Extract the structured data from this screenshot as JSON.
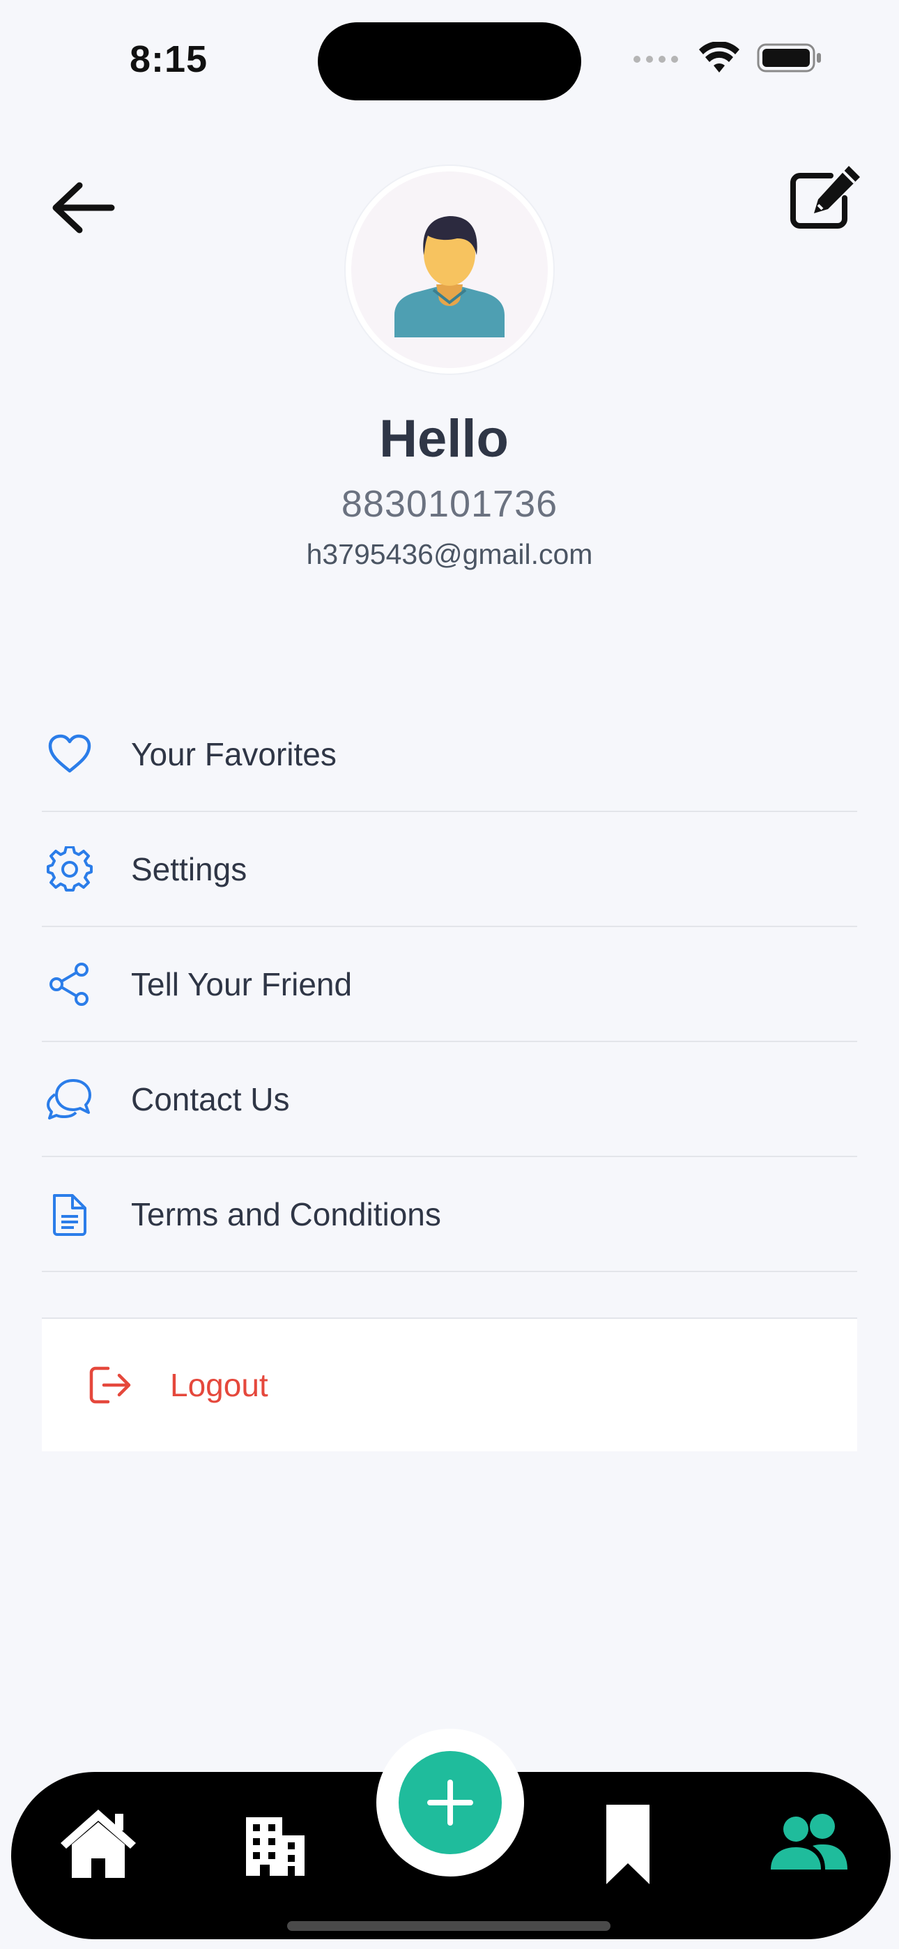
{
  "status_bar": {
    "time": "8:15"
  },
  "header": {
    "back_icon": "arrow-left-icon",
    "edit_icon": "edit-pencil-icon"
  },
  "profile": {
    "avatar_icon": "user-avatar-icon",
    "name": "Hello",
    "phone": "8830101736",
    "email": "h3795436@gmail.com"
  },
  "menu": {
    "items": [
      {
        "label": "Your Favorites",
        "icon": "heart-icon"
      },
      {
        "label": "Settings",
        "icon": "gear-icon"
      },
      {
        "label": "Tell Your Friend",
        "icon": "share-icon"
      },
      {
        "label": "Contact Us",
        "icon": "chat-bubbles-icon"
      },
      {
        "label": "Terms and Conditions",
        "icon": "document-icon"
      }
    ],
    "logout_label": "Logout",
    "logout_icon": "logout-icon"
  },
  "bottom_nav": {
    "tabs": [
      {
        "name": "home",
        "icon": "home-icon",
        "active": false
      },
      {
        "name": "buildings",
        "icon": "building-icon",
        "active": false
      },
      {
        "name": "add",
        "icon": "plus-icon",
        "active": false
      },
      {
        "name": "saved",
        "icon": "bookmark-icon",
        "active": false
      },
      {
        "name": "profile",
        "icon": "users-icon",
        "active": true
      }
    ]
  },
  "colors": {
    "accent_blue": "#2b7de9",
    "danger_red": "#e5483c",
    "fab_green": "#1fbc9c",
    "background": "#f6f7fb"
  }
}
